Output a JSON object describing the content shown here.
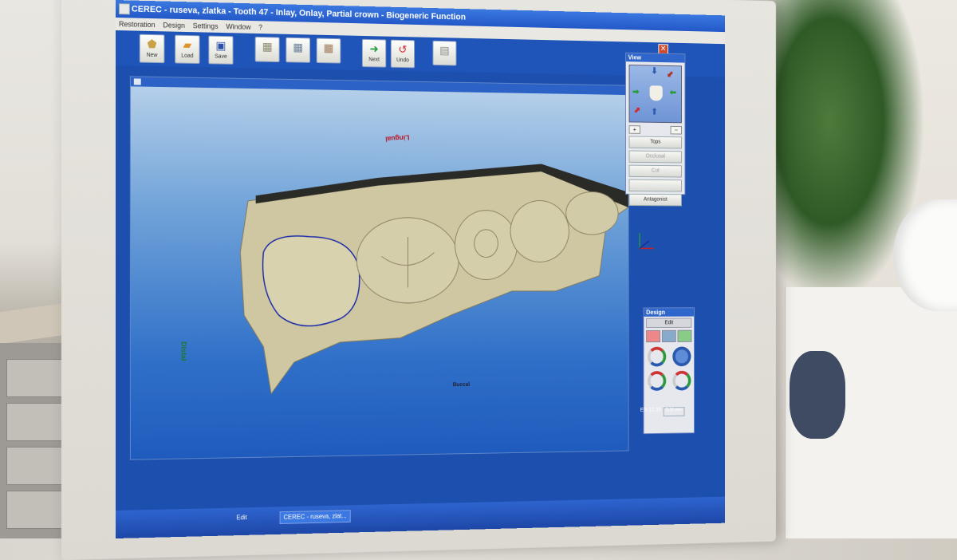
{
  "window": {
    "title": "CEREC - ruseva, zlatka - Tooth 47 - Inlay, Onlay, Partial crown - Biogeneric Function"
  },
  "menu": [
    "Restoration",
    "Design",
    "Settings",
    "Window",
    "?"
  ],
  "toolbar": {
    "new_label": "New",
    "load_label": "Load",
    "save_label": "Save",
    "next_label": "Next",
    "undo_label": "Undo"
  },
  "viewport": {
    "labels": {
      "lingual": "Lingual",
      "distal": "Distal",
      "buccal": "Buccal"
    }
  },
  "view_panel": {
    "title": "View",
    "plus": "+",
    "minus": "−",
    "buttons": [
      "Tops",
      "Occlusal",
      "Cut",
      "",
      "Antagonist"
    ]
  },
  "design_panel": {
    "title": "Design",
    "edit_label": "Edit"
  },
  "status": {
    "value": "5.20 mm",
    "time": "12:35",
    "lang": "EN"
  },
  "taskbar": {
    "items": [
      "Edit",
      "CEREC - ruseva, zlat..."
    ]
  },
  "colors": {
    "title_blue": "#2358c8",
    "viewport_top": "#b9d2ea",
    "viewport_bottom": "#1f5bbd",
    "model": "#cfc7a2",
    "outline": "#1c2aa8"
  },
  "icons": [
    "tooth-icon",
    "folder-icon",
    "floppy-icon",
    "next-arrow-icon",
    "undo-arrow-icon",
    "close-icon"
  ]
}
